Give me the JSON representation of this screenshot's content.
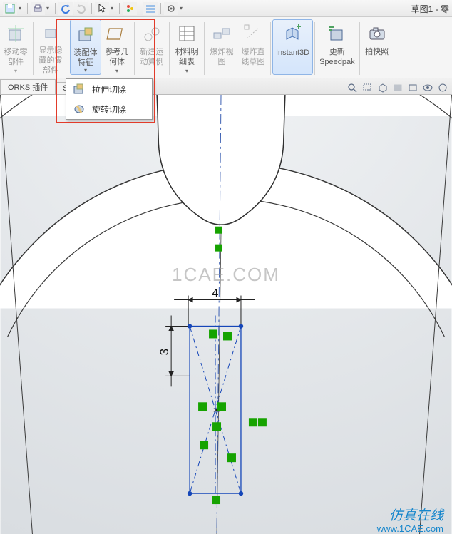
{
  "title": "草图1 - 零",
  "ribbon": {
    "move": "移动零\n部件",
    "show_hidden": "显示隐\n藏的零\n部件",
    "asm_feature": "装配体\n特征",
    "ref_geom": "参考几\n何体",
    "new_motion": "新建运\n动算例",
    "bom": "材料明\n细表",
    "explode_view": "爆炸视\n图",
    "explode_sketch": "爆炸直\n线草图",
    "instant3d": "Instant3D",
    "speedpak": "更新\nSpeedpak",
    "snapshot": "拍快照"
  },
  "tabs": {
    "orks": "ORKS 插件",
    "sol": "SOL"
  },
  "dropdown": {
    "extrude_cut": "拉伸切除",
    "revolve_cut": "旋转切除"
  },
  "dims": {
    "h": "4",
    "v": "3"
  },
  "watermarks": {
    "site": "1CAE.COM",
    "brand": "仿真在线",
    "url": "www.1CAE.com"
  }
}
